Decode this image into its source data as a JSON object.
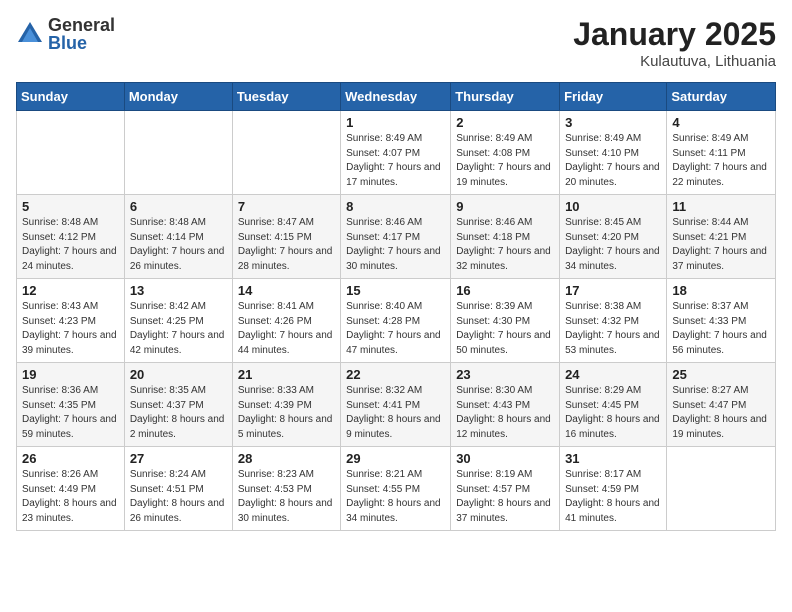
{
  "logo": {
    "general": "General",
    "blue": "Blue"
  },
  "title": "January 2025",
  "location": "Kulautuva, Lithuania",
  "days_of_week": [
    "Sunday",
    "Monday",
    "Tuesday",
    "Wednesday",
    "Thursday",
    "Friday",
    "Saturday"
  ],
  "weeks": [
    [
      {
        "day": "",
        "sunrise": "",
        "sunset": "",
        "daylight": ""
      },
      {
        "day": "",
        "sunrise": "",
        "sunset": "",
        "daylight": ""
      },
      {
        "day": "",
        "sunrise": "",
        "sunset": "",
        "daylight": ""
      },
      {
        "day": "1",
        "sunrise": "Sunrise: 8:49 AM",
        "sunset": "Sunset: 4:07 PM",
        "daylight": "Daylight: 7 hours and 17 minutes."
      },
      {
        "day": "2",
        "sunrise": "Sunrise: 8:49 AM",
        "sunset": "Sunset: 4:08 PM",
        "daylight": "Daylight: 7 hours and 19 minutes."
      },
      {
        "day": "3",
        "sunrise": "Sunrise: 8:49 AM",
        "sunset": "Sunset: 4:10 PM",
        "daylight": "Daylight: 7 hours and 20 minutes."
      },
      {
        "day": "4",
        "sunrise": "Sunrise: 8:49 AM",
        "sunset": "Sunset: 4:11 PM",
        "daylight": "Daylight: 7 hours and 22 minutes."
      }
    ],
    [
      {
        "day": "5",
        "sunrise": "Sunrise: 8:48 AM",
        "sunset": "Sunset: 4:12 PM",
        "daylight": "Daylight: 7 hours and 24 minutes."
      },
      {
        "day": "6",
        "sunrise": "Sunrise: 8:48 AM",
        "sunset": "Sunset: 4:14 PM",
        "daylight": "Daylight: 7 hours and 26 minutes."
      },
      {
        "day": "7",
        "sunrise": "Sunrise: 8:47 AM",
        "sunset": "Sunset: 4:15 PM",
        "daylight": "Daylight: 7 hours and 28 minutes."
      },
      {
        "day": "8",
        "sunrise": "Sunrise: 8:46 AM",
        "sunset": "Sunset: 4:17 PM",
        "daylight": "Daylight: 7 hours and 30 minutes."
      },
      {
        "day": "9",
        "sunrise": "Sunrise: 8:46 AM",
        "sunset": "Sunset: 4:18 PM",
        "daylight": "Daylight: 7 hours and 32 minutes."
      },
      {
        "day": "10",
        "sunrise": "Sunrise: 8:45 AM",
        "sunset": "Sunset: 4:20 PM",
        "daylight": "Daylight: 7 hours and 34 minutes."
      },
      {
        "day": "11",
        "sunrise": "Sunrise: 8:44 AM",
        "sunset": "Sunset: 4:21 PM",
        "daylight": "Daylight: 7 hours and 37 minutes."
      }
    ],
    [
      {
        "day": "12",
        "sunrise": "Sunrise: 8:43 AM",
        "sunset": "Sunset: 4:23 PM",
        "daylight": "Daylight: 7 hours and 39 minutes."
      },
      {
        "day": "13",
        "sunrise": "Sunrise: 8:42 AM",
        "sunset": "Sunset: 4:25 PM",
        "daylight": "Daylight: 7 hours and 42 minutes."
      },
      {
        "day": "14",
        "sunrise": "Sunrise: 8:41 AM",
        "sunset": "Sunset: 4:26 PM",
        "daylight": "Daylight: 7 hours and 44 minutes."
      },
      {
        "day": "15",
        "sunrise": "Sunrise: 8:40 AM",
        "sunset": "Sunset: 4:28 PM",
        "daylight": "Daylight: 7 hours and 47 minutes."
      },
      {
        "day": "16",
        "sunrise": "Sunrise: 8:39 AM",
        "sunset": "Sunset: 4:30 PM",
        "daylight": "Daylight: 7 hours and 50 minutes."
      },
      {
        "day": "17",
        "sunrise": "Sunrise: 8:38 AM",
        "sunset": "Sunset: 4:32 PM",
        "daylight": "Daylight: 7 hours and 53 minutes."
      },
      {
        "day": "18",
        "sunrise": "Sunrise: 8:37 AM",
        "sunset": "Sunset: 4:33 PM",
        "daylight": "Daylight: 7 hours and 56 minutes."
      }
    ],
    [
      {
        "day": "19",
        "sunrise": "Sunrise: 8:36 AM",
        "sunset": "Sunset: 4:35 PM",
        "daylight": "Daylight: 7 hours and 59 minutes."
      },
      {
        "day": "20",
        "sunrise": "Sunrise: 8:35 AM",
        "sunset": "Sunset: 4:37 PM",
        "daylight": "Daylight: 8 hours and 2 minutes."
      },
      {
        "day": "21",
        "sunrise": "Sunrise: 8:33 AM",
        "sunset": "Sunset: 4:39 PM",
        "daylight": "Daylight: 8 hours and 5 minutes."
      },
      {
        "day": "22",
        "sunrise": "Sunrise: 8:32 AM",
        "sunset": "Sunset: 4:41 PM",
        "daylight": "Daylight: 8 hours and 9 minutes."
      },
      {
        "day": "23",
        "sunrise": "Sunrise: 8:30 AM",
        "sunset": "Sunset: 4:43 PM",
        "daylight": "Daylight: 8 hours and 12 minutes."
      },
      {
        "day": "24",
        "sunrise": "Sunrise: 8:29 AM",
        "sunset": "Sunset: 4:45 PM",
        "daylight": "Daylight: 8 hours and 16 minutes."
      },
      {
        "day": "25",
        "sunrise": "Sunrise: 8:27 AM",
        "sunset": "Sunset: 4:47 PM",
        "daylight": "Daylight: 8 hours and 19 minutes."
      }
    ],
    [
      {
        "day": "26",
        "sunrise": "Sunrise: 8:26 AM",
        "sunset": "Sunset: 4:49 PM",
        "daylight": "Daylight: 8 hours and 23 minutes."
      },
      {
        "day": "27",
        "sunrise": "Sunrise: 8:24 AM",
        "sunset": "Sunset: 4:51 PM",
        "daylight": "Daylight: 8 hours and 26 minutes."
      },
      {
        "day": "28",
        "sunrise": "Sunrise: 8:23 AM",
        "sunset": "Sunset: 4:53 PM",
        "daylight": "Daylight: 8 hours and 30 minutes."
      },
      {
        "day": "29",
        "sunrise": "Sunrise: 8:21 AM",
        "sunset": "Sunset: 4:55 PM",
        "daylight": "Daylight: 8 hours and 34 minutes."
      },
      {
        "day": "30",
        "sunrise": "Sunrise: 8:19 AM",
        "sunset": "Sunset: 4:57 PM",
        "daylight": "Daylight: 8 hours and 37 minutes."
      },
      {
        "day": "31",
        "sunrise": "Sunrise: 8:17 AM",
        "sunset": "Sunset: 4:59 PM",
        "daylight": "Daylight: 8 hours and 41 minutes."
      },
      {
        "day": "",
        "sunrise": "",
        "sunset": "",
        "daylight": ""
      }
    ]
  ]
}
